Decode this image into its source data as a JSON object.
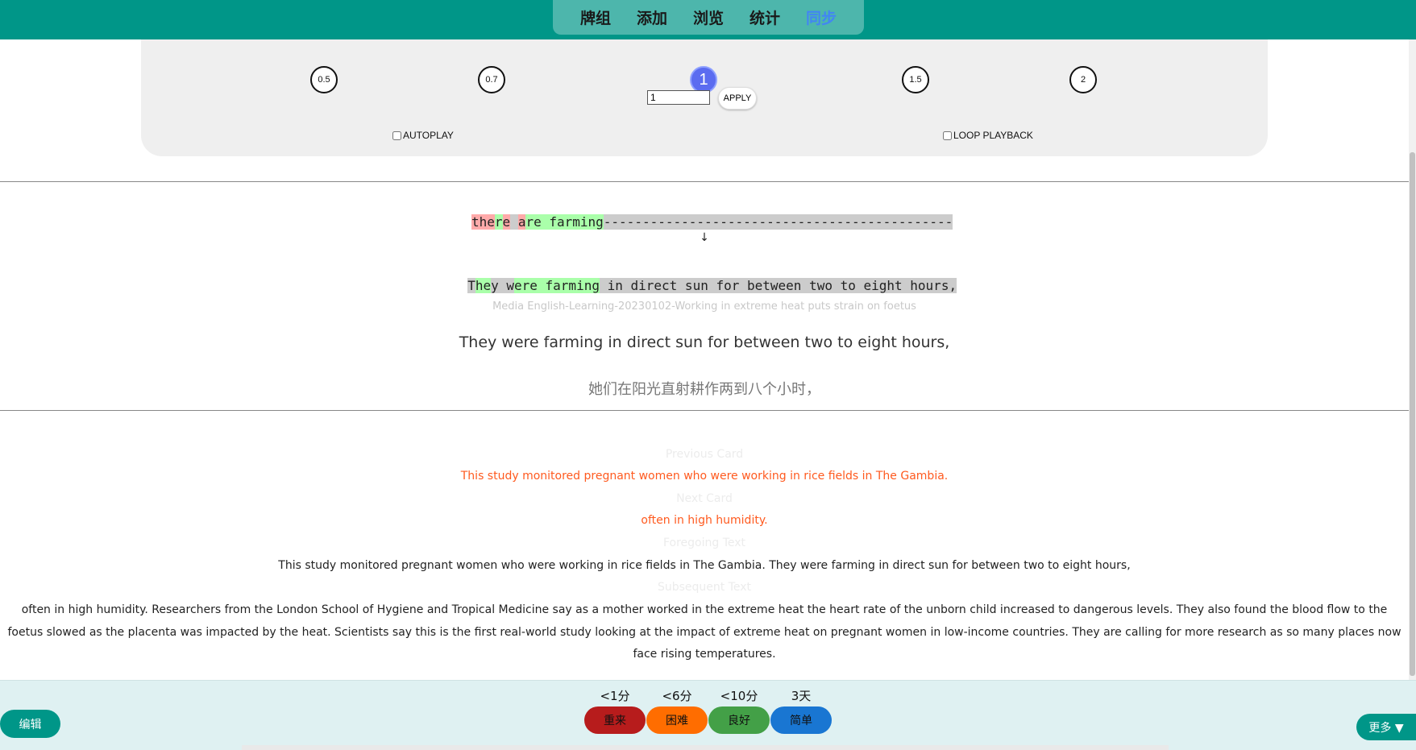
{
  "nav": {
    "items": [
      "牌组",
      "添加",
      "浏览",
      "统计",
      "同步"
    ],
    "active_index": 4
  },
  "player": {
    "speeds": [
      "0.5",
      "0.7",
      "1",
      "1.5",
      "2"
    ],
    "active_speed": "1",
    "rate_value": "1",
    "apply_label": "APPLY",
    "autoplay_label": "AUTOPLAY",
    "loop_label": "LOOP PLAYBACK"
  },
  "diff": {
    "typed": [
      {
        "text": "the",
        "style": "r"
      },
      {
        "text": "r",
        "style": "g"
      },
      {
        "text": "e",
        "style": "r"
      },
      {
        "text": " ",
        "style": "gr"
      },
      {
        "text": "a",
        "style": "r"
      },
      {
        "text": "re farming",
        "style": "g"
      },
      {
        "text": "---------------------------------------------",
        "style": "gr"
      }
    ],
    "arrow": "↓",
    "expected": [
      {
        "text": "T",
        "style": "gr"
      },
      {
        "text": "he",
        "style": "g"
      },
      {
        "text": "y w",
        "style": "gr"
      },
      {
        "text": "ere farming",
        "style": "g"
      },
      {
        "text": " in direct sun for between two to eight hours,",
        "style": "gr"
      }
    ]
  },
  "card": {
    "source": "Media English-Learning-20230102-Working in extreme heat puts strain on foetus",
    "sentence_en": "They were farming in direct sun for between two to eight hours,",
    "sentence_zh": "她们在阳光直射耕作两到八个小时，"
  },
  "context": {
    "previous_label": "Previous Card",
    "previous_text": "This study monitored pregnant women who were working in rice fields in The Gambia.",
    "next_label": "Next Card",
    "next_text": "often in high humidity.",
    "foregoing_label": "Foregoing Text",
    "foregoing_text": "This study monitored pregnant women who were working in rice fields in The Gambia. They were farming in direct sun for between two to eight hours,",
    "subsequent_label": "Subsequent Text",
    "subsequent_text": "often in high humidity. Researchers from the London School of Hygiene and Tropical Medicine say as a mother worked in the extreme heat the heart rate of the unborn child increased to dangerous levels. They also found the blood flow to the foetus slowed as the placenta was impacted by the heat. Scientists say this is the first real-world study looking at the impact of extreme heat on pregnant women in low-income countries. They are calling for more research as so many places now face rising temperatures."
  },
  "answer": {
    "edit_label": "编辑",
    "more_label": "更多 ▼",
    "buttons": [
      {
        "time": "<1分",
        "label": "重来",
        "color": "#b71c1c"
      },
      {
        "time": "<6分",
        "label": "困难",
        "color": "#ff6d00"
      },
      {
        "time": "<10分",
        "label": "良好",
        "color": "#43a047"
      },
      {
        "time": "3天",
        "label": "简单",
        "color": "#1976d2"
      }
    ]
  },
  "colors": {
    "header": "#009688",
    "nav_pill": "#4db6ac",
    "active_nav": "#4285f4",
    "panel": "#efefef",
    "diff_match": "#aaffaa",
    "diff_error": "#ffaaaa",
    "diff_missing": "#cccccc",
    "context_highlight": "#ff5a1f",
    "bottom_bar": "#dff1f2"
  }
}
